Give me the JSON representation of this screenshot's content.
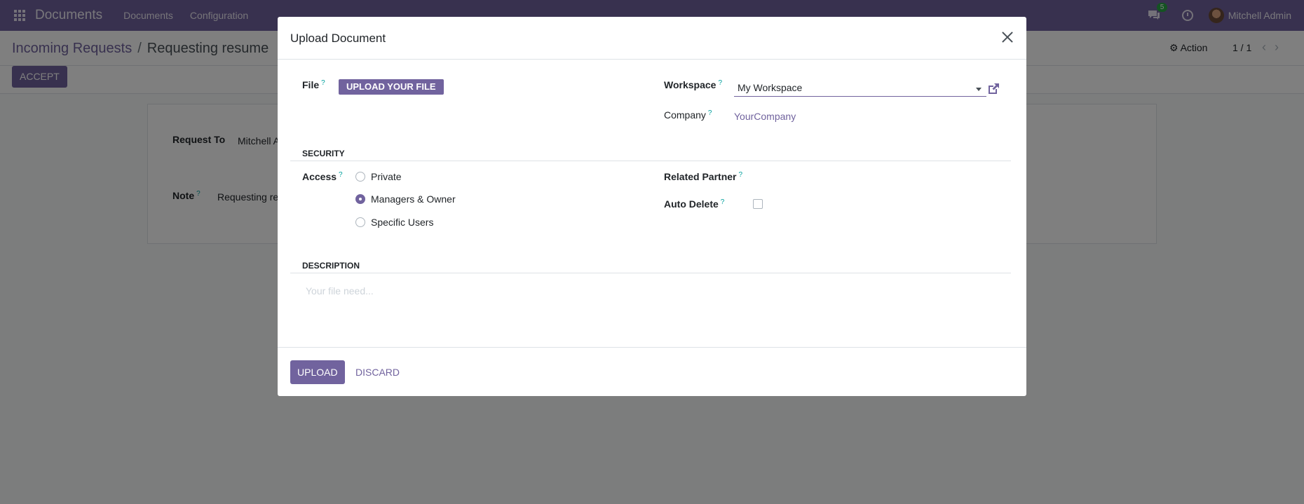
{
  "navbar": {
    "brand": "Documents",
    "menus": [
      "Documents",
      "Configuration"
    ],
    "chat_badge": "5",
    "user_name": "Mitchell Admin",
    "accent": "#71639e"
  },
  "control_panel": {
    "breadcrumb_parent": "Incoming Requests",
    "breadcrumb_separator": "/",
    "breadcrumb_current": "Requesting resume",
    "action_label": "Action",
    "pager": "1 / 1"
  },
  "buttons": {
    "accept": "ACCEPT"
  },
  "background_form": {
    "request_to_label": "Request To",
    "request_to_value": "Mitchell A",
    "note_label": "Note",
    "note_value": "Requesting re"
  },
  "modal": {
    "title": "Upload Document",
    "file_label": "File",
    "upload_file_button": "UPLOAD YOUR FILE",
    "workspace_label": "Workspace",
    "workspace_value": "My Workspace",
    "company_label": "Company",
    "company_value": "YourCompany",
    "security_title": "SECURITY",
    "access_label": "Access",
    "access_options": [
      {
        "label": "Private",
        "checked": false
      },
      {
        "label": "Managers & Owner",
        "checked": true
      },
      {
        "label": "Specific Users",
        "checked": false
      }
    ],
    "related_partner_label": "Related Partner",
    "auto_delete_label": "Auto Delete",
    "auto_delete_checked": false,
    "description_title": "DESCRIPTION",
    "description_placeholder": "Your file need...",
    "tooltip_mark": "?",
    "footer": {
      "upload": "UPLOAD",
      "discard": "DISCARD"
    }
  }
}
